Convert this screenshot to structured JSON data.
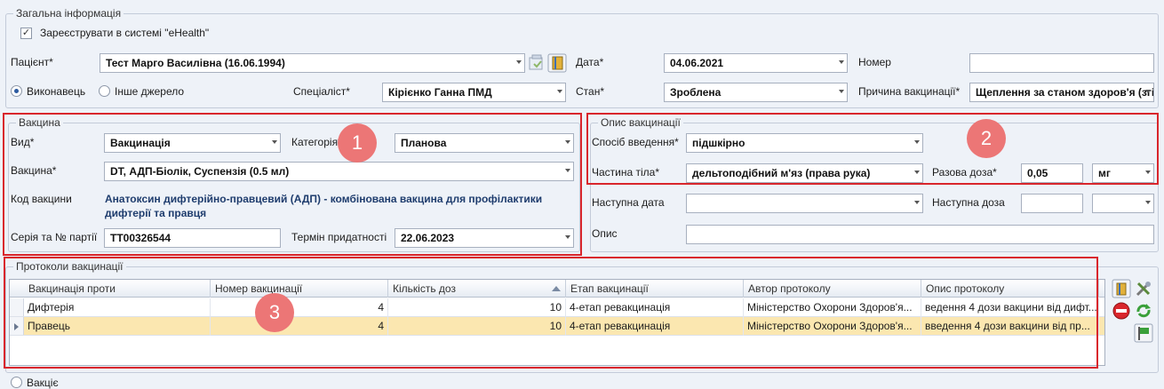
{
  "general": {
    "legend": "Загальна інформація",
    "ehealth_label": "Зареєструвати в системі \"eHealth\"",
    "ehealth_checked": true,
    "patient_label": "Пацієнт*",
    "patient_value": "Тест Марго Василівна (16.06.1994)",
    "date_label": "Дата*",
    "date_value": "04.06.2021",
    "number_label": "Номер",
    "number_value": "",
    "performer_radio": "Виконавець",
    "other_source_radio": "Інше джерело",
    "specialist_label": "Спеціаліст*",
    "specialist_value": "Кірієнко Ганна ПМД",
    "state_label": "Стан*",
    "state_value": "Зроблена",
    "reason_label": "Причина вакцинації*",
    "reason_value": "Щеплення за станом здоров'я (згідно"
  },
  "vaccine": {
    "legend": "Вакцина",
    "type_label": "Вид*",
    "type_value": "Вакцинація",
    "category_label": "Категорія*",
    "category_value": "Планова",
    "vaccine_label": "Вакцина*",
    "vaccine_value": "DT, АДП-Біолік, Суспензія (0.5 мл)",
    "code_label": "Код вакцини",
    "code_line1": "Анатоксин дифтерійно-правцевий (АДП) - комбінована вакцина для профілактики",
    "code_line2": "дифтерії та правця",
    "batch_label": "Серія та № партії",
    "batch_value": "TT00326544",
    "expiry_label": "Термін придатності",
    "expiry_value": "22.06.2023"
  },
  "description": {
    "legend": "Опис вакцинації",
    "route_label": "Спосіб введення*",
    "route_value": "підшкірно",
    "body_part_label": "Частина тіла*",
    "body_part_value": "дельтоподібний м'яз (права рука)",
    "dose_label": "Разова доза*",
    "dose_value": "0,05",
    "dose_unit": "мг",
    "next_date_label": "Наступна дата",
    "next_date_value": "",
    "next_dose_label": "Наступна доза",
    "next_dose_value": "",
    "note_label": "Опис",
    "note_value": ""
  },
  "protocols": {
    "legend": "Протоколи вакцинації",
    "columns": [
      "Вакцинація проти",
      "Номер вакцинації",
      "Кількість доз",
      "Етап вакцинації",
      "Автор протоколу",
      "Опис протоколу"
    ],
    "rows": [
      [
        "Дифтерія",
        "4",
        "10",
        "4-етап ревакцинація",
        "Міністерство Охорони Здоров'я...",
        "ведення 4 дози вакцини від дифт..."
      ],
      [
        "Правець",
        "4",
        "10",
        "4-етап ревакцинація",
        "Міністерство Охорони Здоров'я...",
        "введення 4 дози вакцини від  пр..."
      ]
    ]
  },
  "bottom": {
    "partial_label": "Вакціє"
  },
  "badges": [
    "1",
    "2",
    "3"
  ],
  "colors": {
    "background": "#eef2f8",
    "highlight_box": "#d9262c",
    "badge": "#ec7676",
    "selected_row": "#fbe7b0"
  }
}
